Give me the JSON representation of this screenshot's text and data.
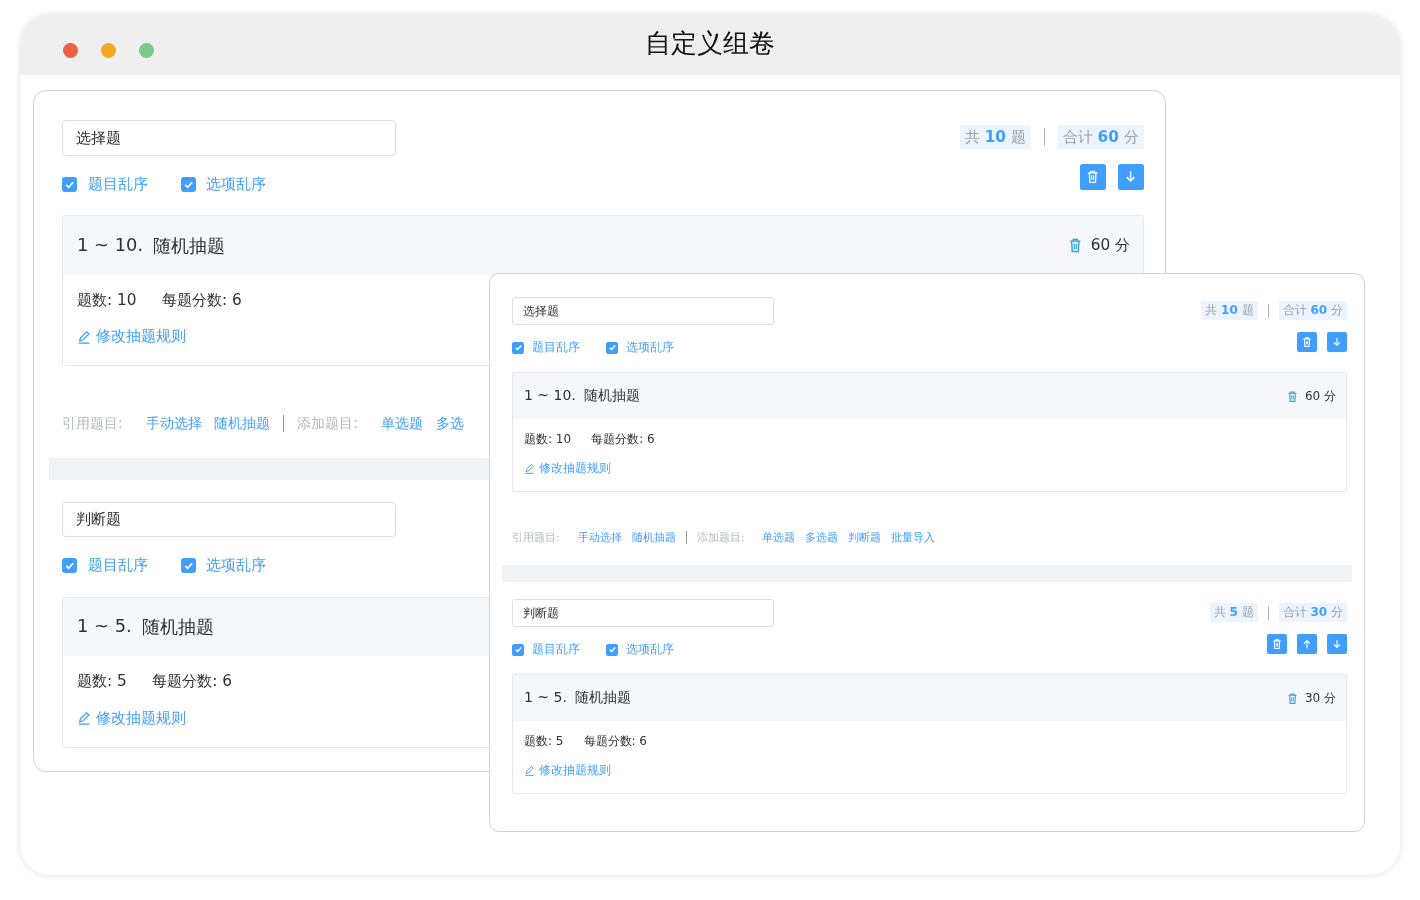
{
  "window": {
    "title": "自定义组卷"
  },
  "panels": [
    {
      "sections": [
        {
          "name_field": {
            "value": "选择题"
          },
          "options": [
            {
              "label": "题目乱序",
              "checked": true
            },
            {
              "label": "选项乱序",
              "checked": true
            }
          ],
          "summary": {
            "count": "共 **10** 题",
            "total": "合计 **60** 分"
          },
          "actions": [
            {
              "kind": "delete"
            },
            {
              "kind": "down"
            }
          ],
          "rules": [
            {
              "range": "1 ~ 10.",
              "title": "随机抽题",
              "score": "60 分",
              "count_label": "题数: 10",
              "score_label": "每题分数: 6",
              "edit_link": "修改抽题规则"
            }
          ],
          "toolbar": {
            "cite_label": "引用题目:",
            "cite_links": [
              "手动选择",
              "随机抽题"
            ],
            "add_label": "添加题目:",
            "add_links": [
              "单选题",
              "多选"
            ]
          }
        },
        {
          "name_field": {
            "value": "判断题"
          },
          "options": [
            {
              "label": "题目乱序",
              "checked": true
            },
            {
              "label": "选项乱序",
              "checked": true
            }
          ],
          "rules": [
            {
              "range": "1 ~ 5.",
              "title": "随机抽题",
              "count_label": "题数: 5",
              "score_label": "每题分数: 6",
              "edit_link": "修改抽题规则"
            }
          ]
        }
      ]
    },
    {
      "sections": [
        {
          "name_field": {
            "value": "选择题"
          },
          "options": [
            {
              "label": "题目乱序",
              "checked": true
            },
            {
              "label": "选项乱序",
              "checked": true
            }
          ],
          "summary": {
            "count": "共 **10** 题",
            "total": "合计 **60** 分"
          },
          "actions": [
            {
              "kind": "delete"
            },
            {
              "kind": "down"
            }
          ],
          "rules": [
            {
              "range": "1 ~ 10.",
              "title": "随机抽题",
              "score": "60 分",
              "count_label": "题数: 10",
              "score_label": "每题分数: 6",
              "edit_link": "修改抽题规则"
            }
          ],
          "toolbar": {
            "cite_label": "引用题目:",
            "cite_links": [
              "手动选择",
              "随机抽题"
            ],
            "add_label": "添加题目:",
            "add_links": [
              "单选题",
              "多选题",
              "判断题",
              "批量导入"
            ]
          }
        },
        {
          "name_field": {
            "value": "判断题"
          },
          "options": [
            {
              "label": "题目乱序",
              "checked": true
            },
            {
              "label": "选项乱序",
              "checked": true
            }
          ],
          "summary": {
            "count": "共 **5** 题",
            "total": "合计 **30** 分"
          },
          "actions": [
            {
              "kind": "delete"
            },
            {
              "kind": "up"
            },
            {
              "kind": "down"
            }
          ],
          "rules": [
            {
              "range": "1 ~ 5.",
              "title": "随机抽题",
              "score": "30 分",
              "count_label": "题数: 5",
              "score_label": "每题分数: 6",
              "edit_link": "修改抽题规则"
            }
          ]
        }
      ]
    }
  ]
}
